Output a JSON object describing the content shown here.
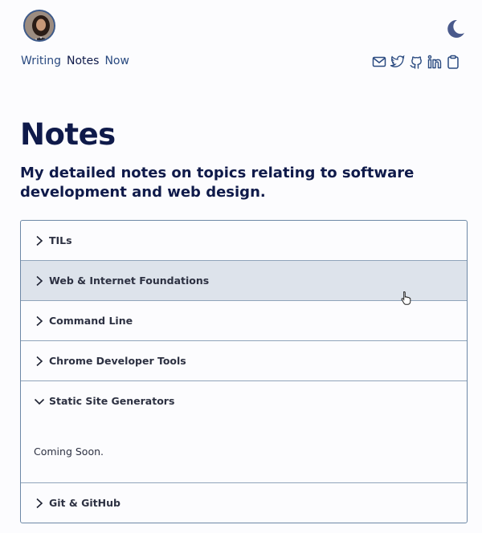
{
  "header": {
    "avatar_icon": "profile-photo",
    "theme_toggle_icon": "moon-icon"
  },
  "nav": {
    "items": [
      {
        "label": "Writing"
      },
      {
        "label": "Notes"
      },
      {
        "label": "Now"
      }
    ],
    "active": "Notes"
  },
  "socials": [
    "mail-icon",
    "twitter-icon",
    "github-icon",
    "linkedin-icon",
    "clipboard-icon"
  ],
  "main": {
    "title": "Notes",
    "subtitle": "My detailed notes on topics relating to software development and web design."
  },
  "accordion": {
    "items": [
      {
        "label": "TILs",
        "expanded": false
      },
      {
        "label": "Web & Internet Foundations",
        "expanded": false,
        "hovered": true
      },
      {
        "label": "Command Line",
        "expanded": false
      },
      {
        "label": "Chrome Developer Tools",
        "expanded": false
      },
      {
        "label": "Static Site Generators",
        "expanded": true,
        "content": "Coming Soon."
      },
      {
        "label": "Git & GitHub",
        "expanded": false
      }
    ]
  },
  "colors": {
    "navy": "#0f1a4a",
    "link": "#2a4a80",
    "hover_bg": "#dde3eb",
    "border": "#6d88a6"
  }
}
